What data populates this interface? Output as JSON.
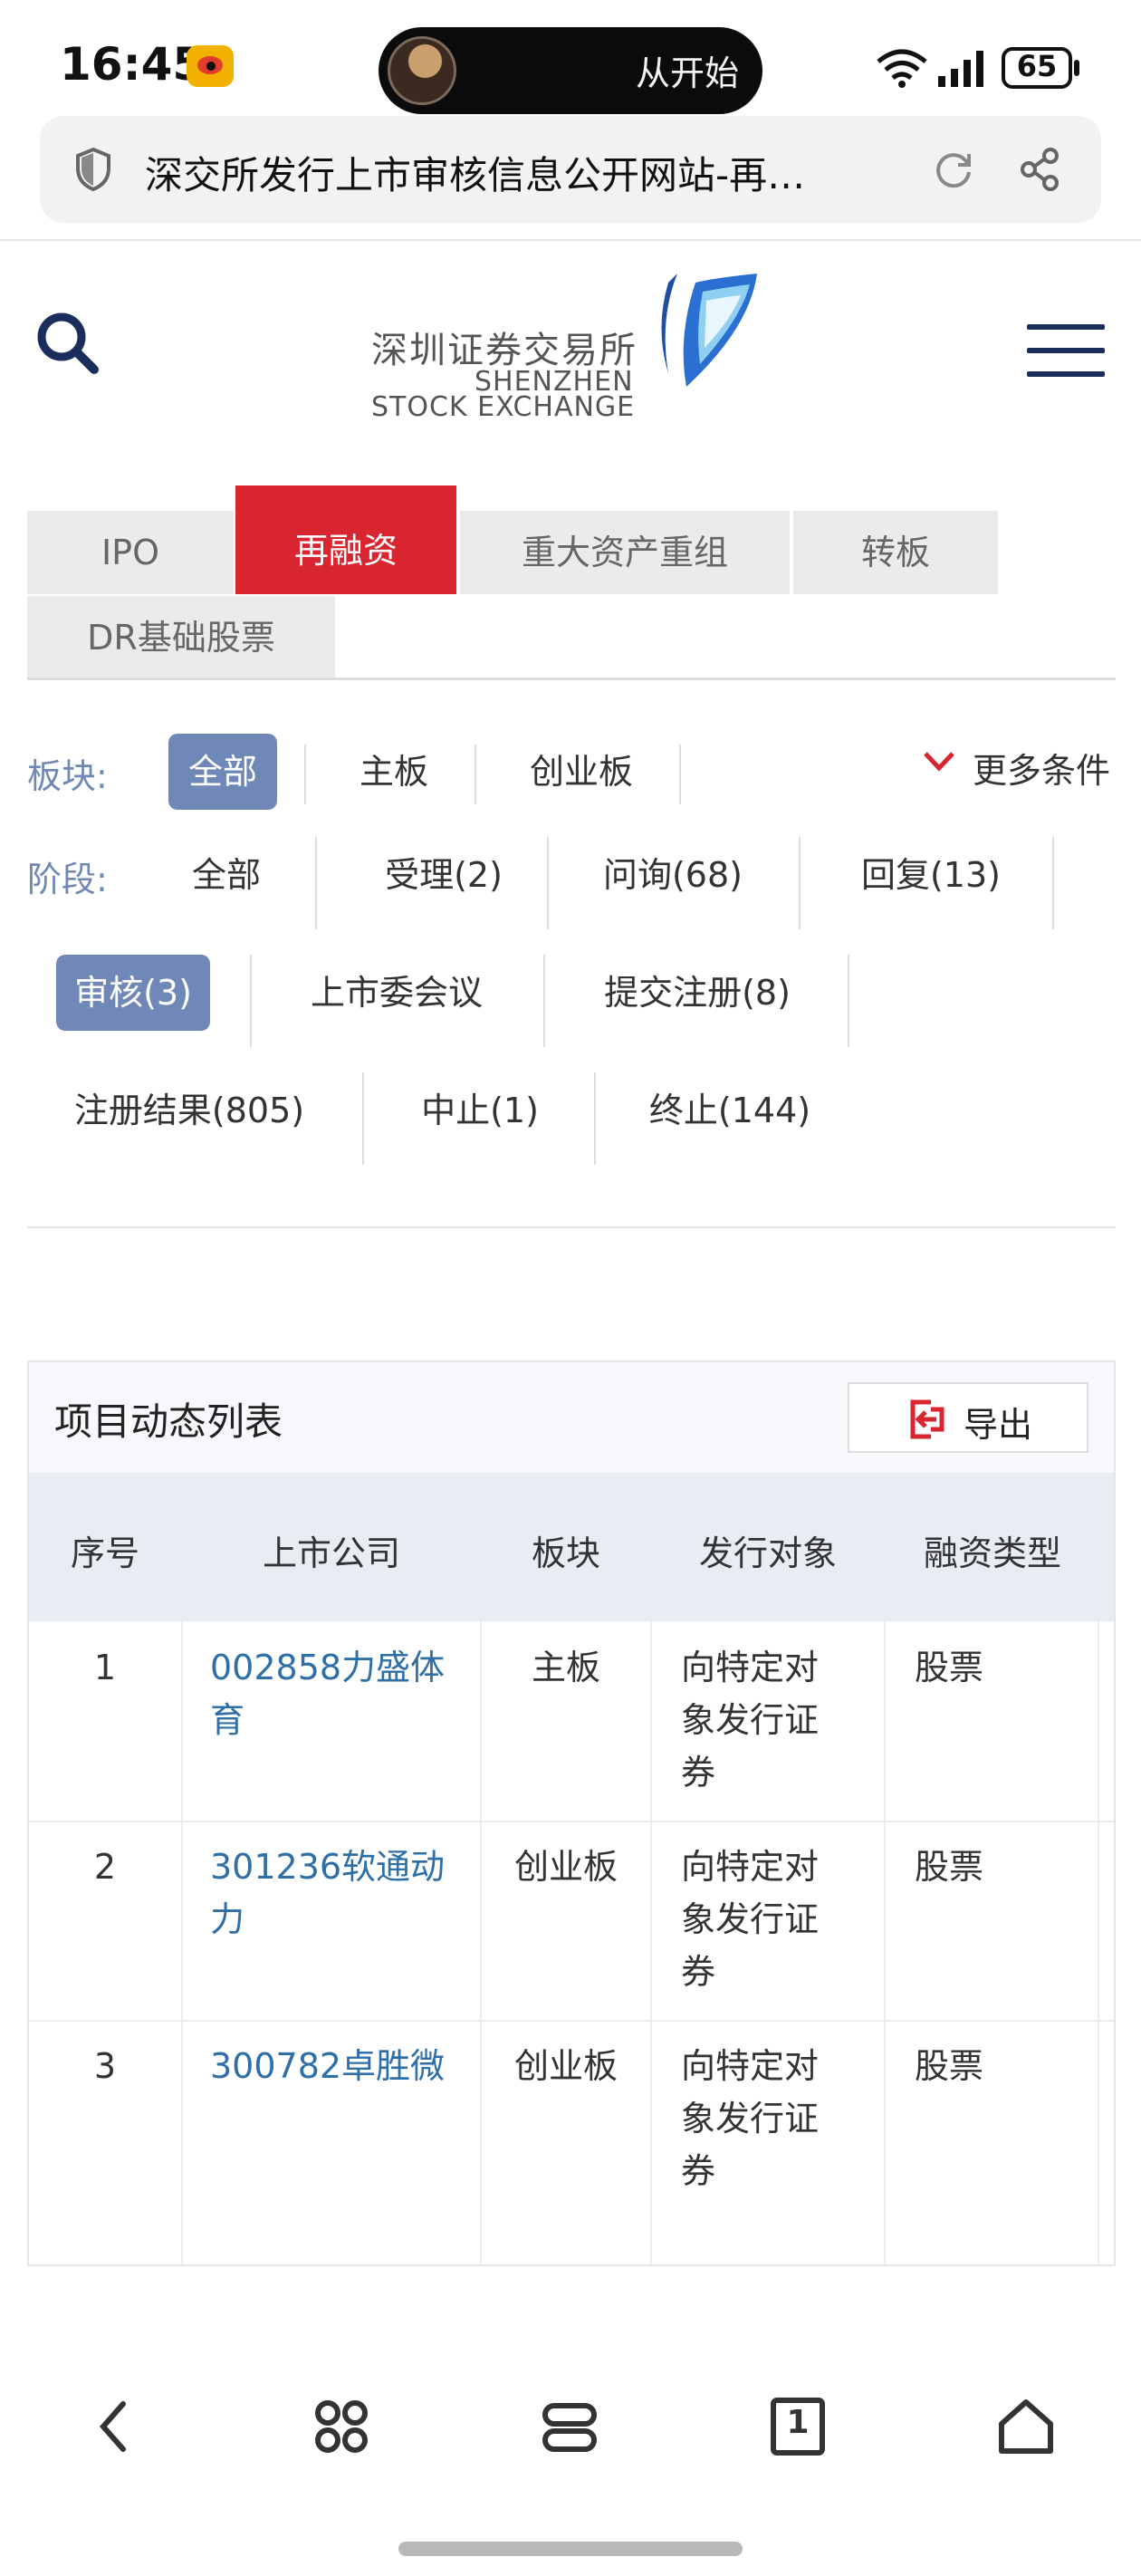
{
  "status_bar": {
    "time": "16:45",
    "island_text": "从开始",
    "battery": "65",
    "icons": [
      "weibo-icon",
      "wifi-icon",
      "signal-icon",
      "battery-icon"
    ]
  },
  "browser": {
    "url_title": "深交所发行上市审核信息公开网站-再…",
    "icons": [
      "shield-icon",
      "reload-icon",
      "share-icon"
    ]
  },
  "header": {
    "logo_cn": "深圳证券交易所",
    "logo_en_line1": "SHENZHEN",
    "logo_en_line2": "STOCK EXCHANGE",
    "icons": [
      "search-icon",
      "menu-icon"
    ]
  },
  "tabs": [
    {
      "label": "IPO",
      "active": false
    },
    {
      "label": "再融资",
      "active": true
    },
    {
      "label": "重大资产重组",
      "active": false
    },
    {
      "label": "转板",
      "active": false
    },
    {
      "label": "DR基础股票",
      "active": false
    }
  ],
  "filters": {
    "board_label": "板块:",
    "boards": [
      "全部",
      "主板",
      "创业板"
    ],
    "more_label": "更多条件",
    "stage_label": "阶段:",
    "stages": [
      "全部",
      "受理(2)",
      "问询(68)",
      "回复(13)",
      "审核(3)",
      "上市委会议",
      "提交注册(8)",
      "注册结果(805)",
      "中止(1)",
      "终止(144)"
    ]
  },
  "table": {
    "title": "项目动态列表",
    "export_label": "导出",
    "headers": [
      "序号",
      "上市公司",
      "板块",
      "发行对象",
      "融资类型"
    ],
    "rows": [
      {
        "no": "1",
        "company_l1": "002858力盛体",
        "company_l2": "育",
        "board": "主板",
        "target_l1": "向特定对",
        "target_l2": "象发行证",
        "target_l3": "券",
        "type": "股票"
      },
      {
        "no": "2",
        "company_l1": "301236软通动",
        "company_l2": "力",
        "board": "创业板",
        "target_l1": "向特定对",
        "target_l2": "象发行证",
        "target_l3": "券",
        "type": "股票"
      },
      {
        "no": "3",
        "company_l1": "300782卓胜微",
        "company_l2": "",
        "board": "创业板",
        "target_l1": "向特定对",
        "target_l2": "象发行证",
        "target_l3": "券",
        "type": "股票"
      }
    ]
  },
  "bottom_nav": [
    "back-icon",
    "apps-icon",
    "tabs-overview-icon",
    "tab-count-icon",
    "home-icon"
  ],
  "bottom_nav_tab_count": "1",
  "colors": {
    "accent_red": "#d8252f",
    "filter_blue": "#7088b8",
    "link_blue": "#2f6fa8",
    "navy": "#1b2d5a"
  }
}
